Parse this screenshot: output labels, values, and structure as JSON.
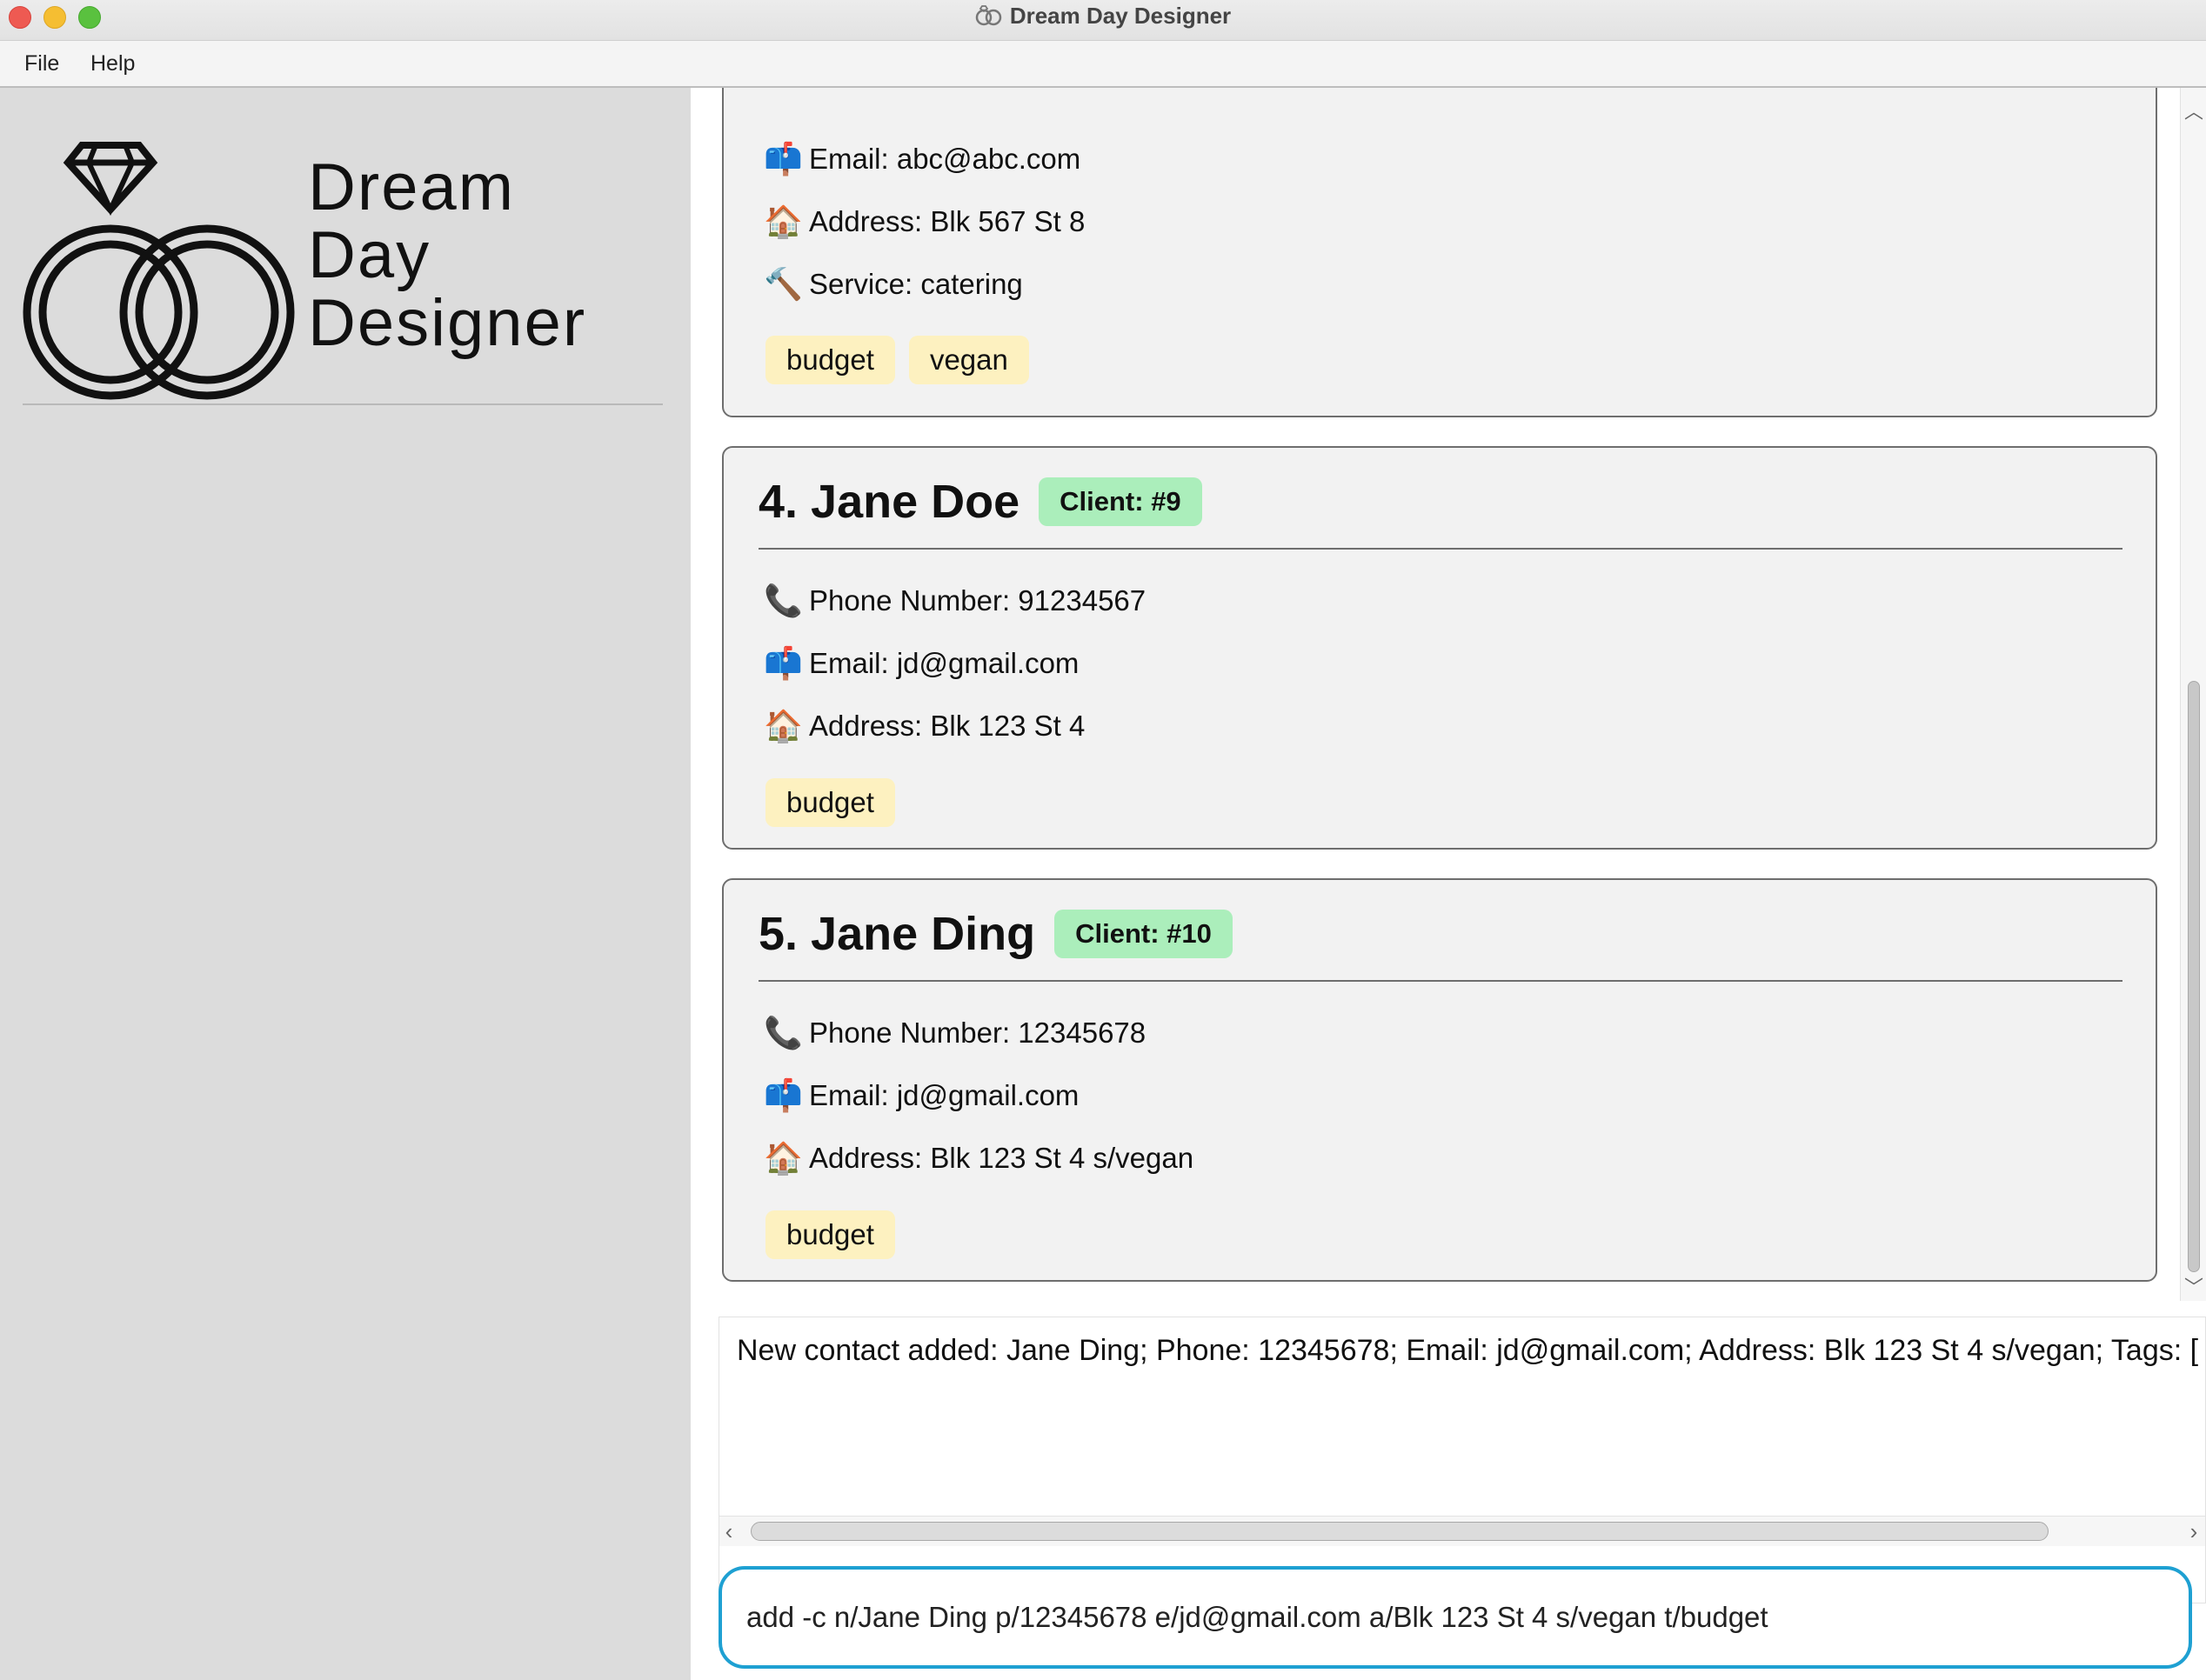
{
  "window": {
    "title": "Dream Day Designer"
  },
  "menu": {
    "file": "File",
    "help": "Help"
  },
  "logo": {
    "line1": "Dream",
    "line2": "Day",
    "line3": "Designer"
  },
  "cards": {
    "c3": {
      "email": "Email: abc@abc.com",
      "address": "Address: Blk 567 St 8",
      "service": "Service: catering",
      "tags": [
        "budget",
        "vegan"
      ],
      "icons": {
        "email": "mailbox-icon",
        "address": "house-icon",
        "service": "hammer-icon"
      }
    },
    "c4": {
      "name": "4. Jane Doe",
      "badge": "Client: #9",
      "phone": "Phone Number: 91234567",
      "email": "Email: jd@gmail.com",
      "address": "Address: Blk 123 St 4",
      "tags": [
        "budget"
      ],
      "icons": {
        "phone": "phone-icon",
        "email": "mailbox-icon",
        "address": "house-icon"
      }
    },
    "c5": {
      "name": "5. Jane Ding",
      "badge": "Client: #10",
      "phone": "Phone Number: 12345678",
      "email": "Email: jd@gmail.com",
      "address": "Address: Blk 123 St 4 s/vegan",
      "tags": [
        "budget"
      ],
      "icons": {
        "phone": "phone-icon",
        "email": "mailbox-icon",
        "address": "house-icon"
      }
    }
  },
  "result": {
    "text": "New contact added: Jane Ding; Phone: 12345678; Email: jd@gmail.com; Address: Blk 123 St 4 s/vegan; Tags: [budg"
  },
  "command": {
    "value": "add -c n/Jane Ding p/12345678 e/jd@gmail.com a/Blk 123 St 4 s/vegan t/budget"
  },
  "colors": {
    "client_badge": "#abeebb",
    "tag": "#fdf1c0",
    "input_focus": "#1ea0d2"
  }
}
